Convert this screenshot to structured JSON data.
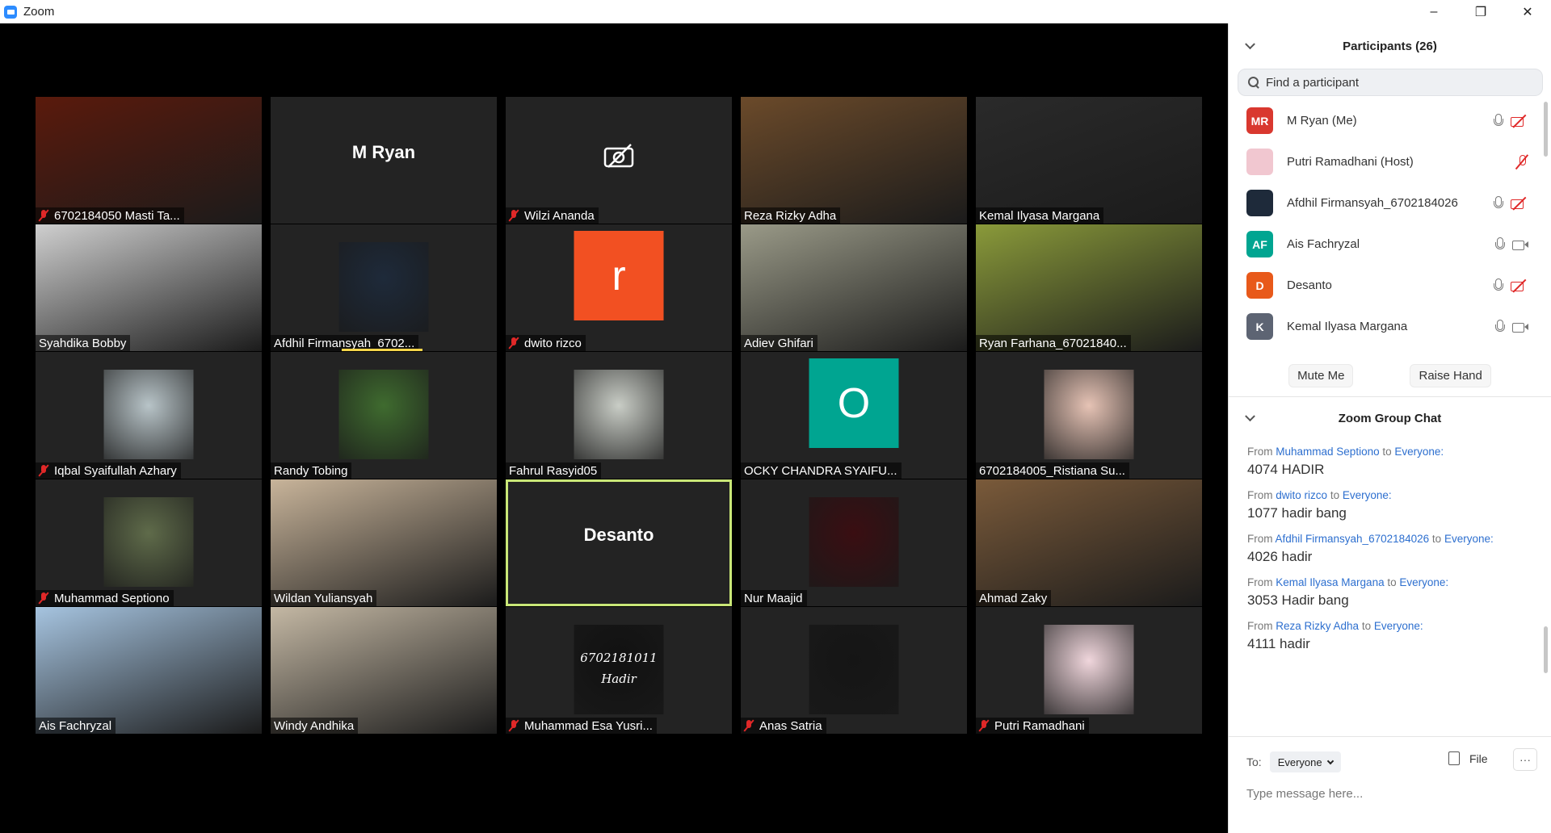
{
  "window": {
    "title": "Zoom",
    "controls": [
      "–",
      "❐",
      "✕"
    ]
  },
  "tiles": [
    {
      "name": "6702184050 Masti Ta...",
      "muted": true,
      "type": "photo",
      "bg": "#5a1a0c"
    },
    {
      "name": "",
      "muted": false,
      "type": "name",
      "center": "M Ryan"
    },
    {
      "name": "Wilzi Ananda",
      "muted": true,
      "type": "camoff"
    },
    {
      "name": "Reza Rizky Adha",
      "muted": false,
      "type": "video",
      "bg": "#6b4a2a"
    },
    {
      "name": "Kemal Ilyasa Margana",
      "muted": false,
      "type": "video",
      "bg": "#2a2a2a"
    },
    {
      "name": "Syahdika Bobby",
      "muted": false,
      "type": "video",
      "bg": "#cfcfcf"
    },
    {
      "name": "Afdhil Firmansyah_6702...",
      "muted": false,
      "type": "photo-small",
      "bg": "#1e2a3a",
      "speaking": true
    },
    {
      "name": "dwito rizco",
      "muted": true,
      "type": "avatar",
      "letter": "r",
      "color": "#f25022"
    },
    {
      "name": "Adiev Ghifari",
      "muted": false,
      "type": "video",
      "bg": "#9a9a88"
    },
    {
      "name": "Ryan Farhana_67021840...",
      "muted": false,
      "type": "video",
      "bg": "#8a9a3a"
    },
    {
      "name": "Iqbal Syaifullah Azhary",
      "muted": true,
      "type": "photo-small",
      "bg": "#b8c4c8"
    },
    {
      "name": "Randy Tobing",
      "muted": false,
      "type": "photo-small",
      "bg": "#3f6b2f"
    },
    {
      "name": "Fahrul Rasyid05",
      "muted": false,
      "type": "photo-small",
      "bg": "#c9cdc6"
    },
    {
      "name": "OCKY CHANDRA SYAIFU...",
      "muted": false,
      "type": "avatar",
      "letter": "O",
      "color": "#00a591"
    },
    {
      "name": "6702184005_Ristiana Su...",
      "muted": false,
      "type": "photo-small",
      "bg": "#e6c3b5"
    },
    {
      "name": "Muhammad Septiono",
      "muted": true,
      "type": "photo-small",
      "bg": "#5f6b4a"
    },
    {
      "name": "Wildan Yuliansyah",
      "muted": false,
      "type": "video",
      "bg": "#c8b49a"
    },
    {
      "name": "",
      "muted": false,
      "type": "name",
      "center": "Desanto",
      "active": true
    },
    {
      "name": "Nur Maajid",
      "muted": false,
      "type": "photo-small",
      "bg": "#3a0e12"
    },
    {
      "name": "Ahmad Zaky",
      "muted": false,
      "type": "video",
      "bg": "#7a5a3a"
    },
    {
      "name": "Ais Fachryzal",
      "muted": false,
      "type": "video",
      "bg": "#a6c4e0"
    },
    {
      "name": "Windy Andhika",
      "muted": false,
      "type": "video",
      "bg": "#c4b8a4"
    },
    {
      "name": "Muhammad Esa Yusri...",
      "muted": true,
      "type": "photo-small",
      "bg": "#111111",
      "caption": "6702181011 Hadir"
    },
    {
      "name": "Anas Satria",
      "muted": true,
      "type": "photo-small",
      "bg": "#151515"
    },
    {
      "name": "Putri Ramadhani",
      "muted": true,
      "type": "photo-small",
      "bg": "#f0d6dc"
    }
  ],
  "participants": {
    "title": "Participants (26)",
    "search_placeholder": "Find a participant",
    "items": [
      {
        "name": "M Ryan (Me)",
        "initials": "MR",
        "color": "#d9382f",
        "mic": true,
        "cam": "off"
      },
      {
        "name": "Putri Ramadhani (Host)",
        "initials": "",
        "color": "#f1c7d0",
        "mic": false,
        "cam": "muted-mic"
      },
      {
        "name": "Afdhil Firmansyah_6702184026",
        "initials": "",
        "color": "#1e2a3a",
        "mic": true,
        "cam": "off"
      },
      {
        "name": "Ais Fachryzal",
        "initials": "AF",
        "color": "#00a591",
        "mic": true,
        "cam": "on"
      },
      {
        "name": "Desanto",
        "initials": "D",
        "color": "#e8591a",
        "mic": true,
        "cam": "off"
      },
      {
        "name": "Kemal Ilyasa Margana",
        "initials": "K",
        "color": "#5d6473",
        "mic": true,
        "cam": "on"
      }
    ],
    "mute_me": "Mute Me",
    "raise_hand": "Raise Hand"
  },
  "chat": {
    "title": "Zoom Group Chat",
    "messages": [
      {
        "from": "Muhammad Septiono",
        "to": "Everyone:",
        "text": "4074 HADIR"
      },
      {
        "from": "dwito rizco",
        "to": "Everyone:",
        "text": "1077 hadir bang"
      },
      {
        "from": "Afdhil Firmansyah_6702184026",
        "to": "Everyone:",
        "text": "4026 hadir"
      },
      {
        "from": "Kemal Ilyasa Margana",
        "to": "Everyone:",
        "text": "3053 Hadir bang"
      },
      {
        "from": "Reza Rizky Adha",
        "to": "Everyone:",
        "text": "4111 hadir"
      }
    ],
    "from_word": "From",
    "to_word": "to",
    "to_label": "To:",
    "to_value": "Everyone",
    "file_label": "File",
    "more_label": "···",
    "input_placeholder": "Type message here..."
  }
}
